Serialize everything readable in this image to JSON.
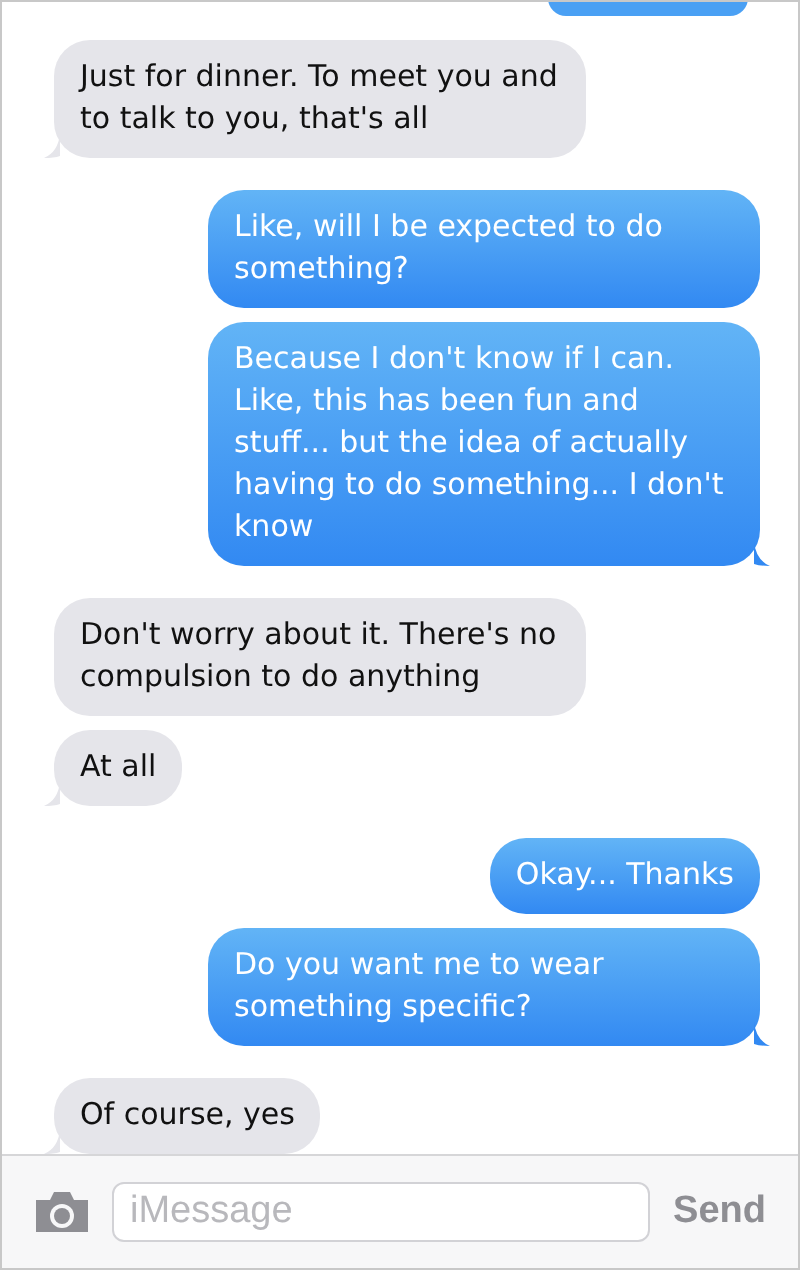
{
  "messages": [
    {
      "sent": false,
      "tail": true,
      "text": "Just for dinner. To meet you and to talk to you, that's all"
    },
    {
      "sent": true,
      "tail": false,
      "text": "Like, will I be expected to do something?"
    },
    {
      "sent": true,
      "tail": true,
      "text": "Because I don't know if I can. Like, this has been fun and stuff... but the idea of actually having to do something... I don't know"
    },
    {
      "sent": false,
      "tail": false,
      "text": "Don't worry about it. There's no compulsion to do anything"
    },
    {
      "sent": false,
      "tail": true,
      "text": "At all"
    },
    {
      "sent": true,
      "tail": false,
      "text": "Okay... Thanks"
    },
    {
      "sent": true,
      "tail": true,
      "text": "Do you want me to wear something specific?"
    },
    {
      "sent": false,
      "tail": true,
      "text": "Of course, yes"
    }
  ],
  "composer": {
    "placeholder": "iMessage",
    "send": "Send"
  }
}
